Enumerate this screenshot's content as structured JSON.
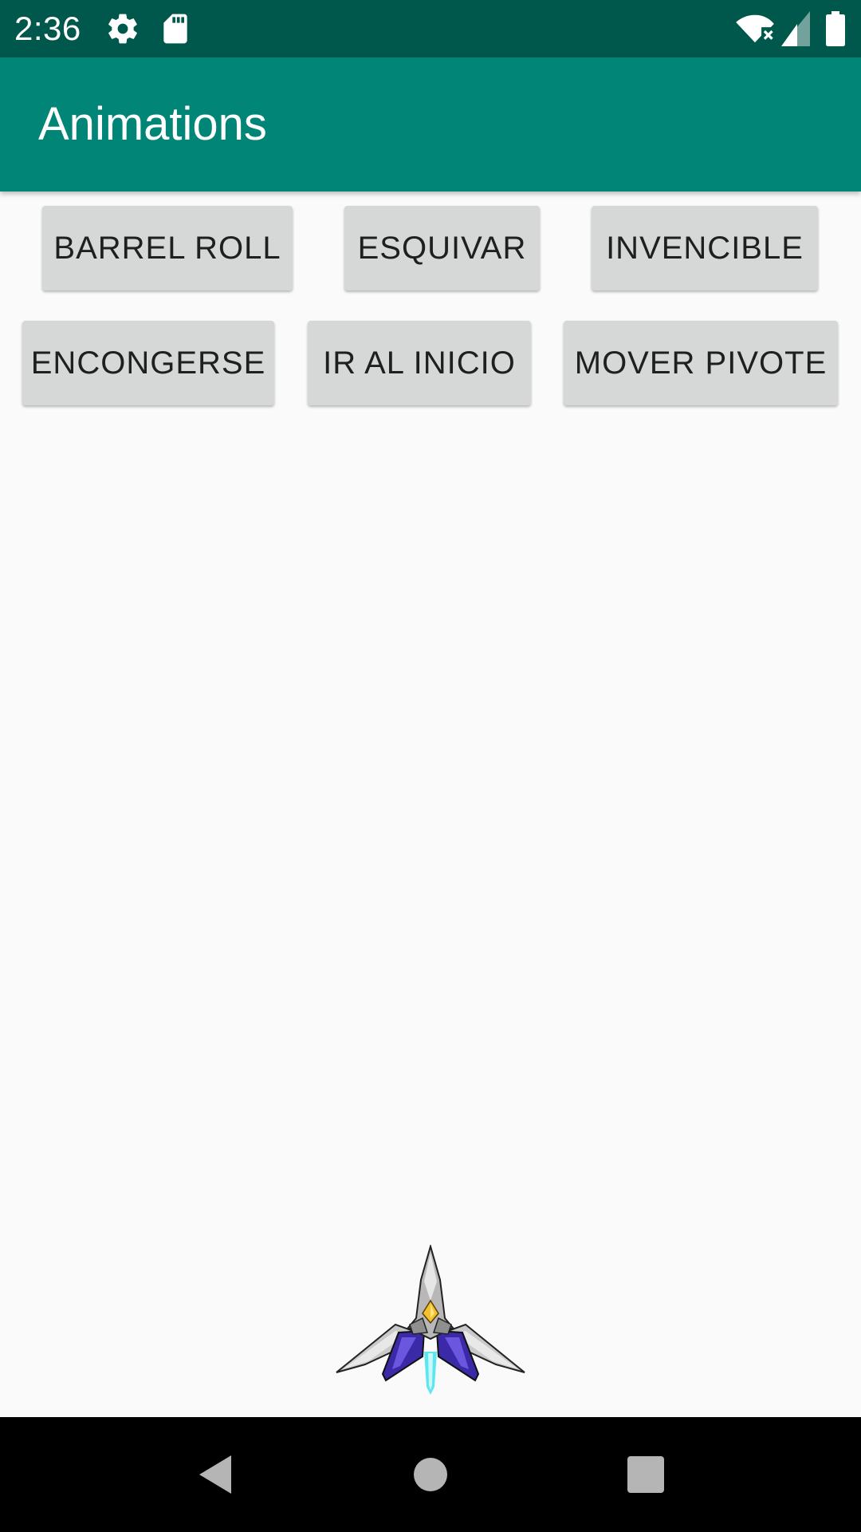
{
  "status_bar": {
    "time": "2:36",
    "icons": [
      "gear-icon",
      "sd-card-icon",
      "wifi-no-internet-icon",
      "cell-signal-icon",
      "battery-icon"
    ]
  },
  "app_bar": {
    "title": "Animations"
  },
  "buttons": {
    "barrel_roll": "BARREL ROLL",
    "esquivar": "ESQUIVAR",
    "invencible": "INVENCIBLE",
    "encongerse": "ENCONGERSE",
    "ir_al_inicio": "IR AL INICIO",
    "mover_pivote": "MOVER PIVOTE"
  },
  "image": {
    "name": "spaceship-sprite"
  },
  "nav_bar": {
    "items": [
      "back-icon",
      "home-icon",
      "recents-icon"
    ]
  },
  "colors": {
    "status_bar": "#00574b",
    "app_bar": "#008577",
    "button": "#d6d7d7",
    "background": "#fafafa"
  }
}
